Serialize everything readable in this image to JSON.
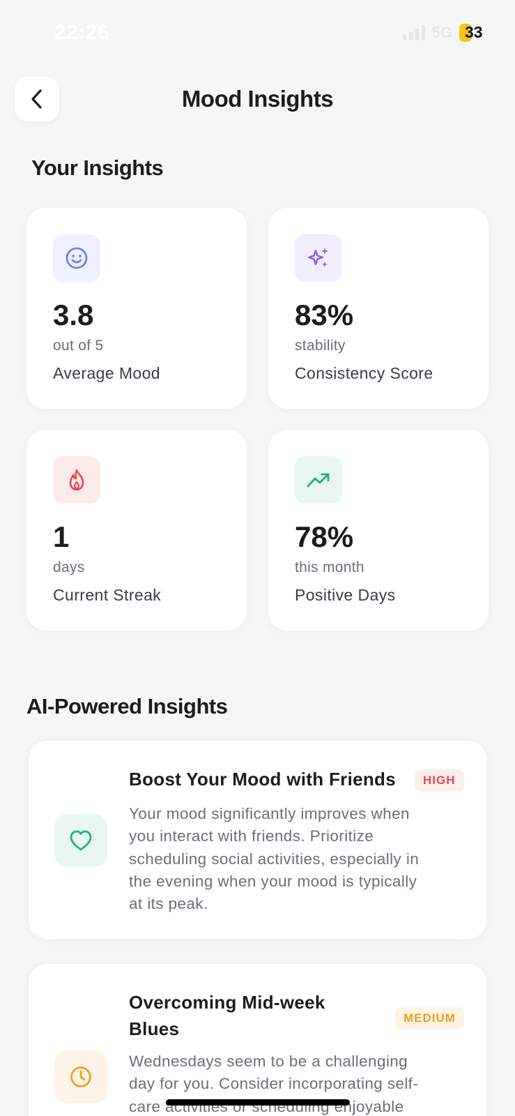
{
  "status": {
    "time": "22:26",
    "network": "5G",
    "battery": "33"
  },
  "header": {
    "title": "Mood Insights"
  },
  "sections": {
    "your_insights": "Your Insights",
    "ai_insights": "AI-Powered Insights"
  },
  "stats": [
    {
      "value": "3.8",
      "sub": "out of 5",
      "label": "Average Mood",
      "icon": "smile-icon",
      "icon_bg": "#eef0fd",
      "icon_color": "#6b7be8"
    },
    {
      "value": "83%",
      "sub": "stability",
      "label": "Consistency Score",
      "icon": "sparkles-icon",
      "icon_bg": "#f2edfd",
      "icon_color": "#8b5cf6"
    },
    {
      "value": "1",
      "sub": "days",
      "label": "Current Streak",
      "icon": "flame-icon",
      "icon_bg": "#fdeaea",
      "icon_color": "#e5484d"
    },
    {
      "value": "78%",
      "sub": "this month",
      "label": "Positive Days",
      "icon": "trending-up-icon",
      "icon_bg": "#e7f7ef",
      "icon_color": "#22b07d"
    }
  ],
  "ai_insights": [
    {
      "title": "Boost Your Mood with Friends",
      "badge": "HIGH",
      "badge_color": "#e5484d",
      "badge_bg": "#fdeeee",
      "icon": "heart-icon",
      "icon_bg": "#e8f7f0",
      "icon_color": "#22b07d",
      "desc": [
        "Your mood significantly improves when",
        "you interact with friends. Prioritize",
        "scheduling social activities, especially in",
        "the evening when your mood is typically",
        "at its peak."
      ]
    },
    {
      "title_lines": [
        "Overcoming Mid-week",
        "Blues"
      ],
      "badge": "MEDIUM",
      "badge_color": "#e5a020",
      "badge_bg": "#fdf4e4",
      "icon": "clock-icon",
      "icon_bg": "#fdf3e6",
      "icon_color": "#f0a020",
      "desc": [
        "Wednesdays seem to be a challenging",
        "day for you. Consider incorporating self-",
        "care activities or scheduling enjoyable"
      ]
    }
  ]
}
